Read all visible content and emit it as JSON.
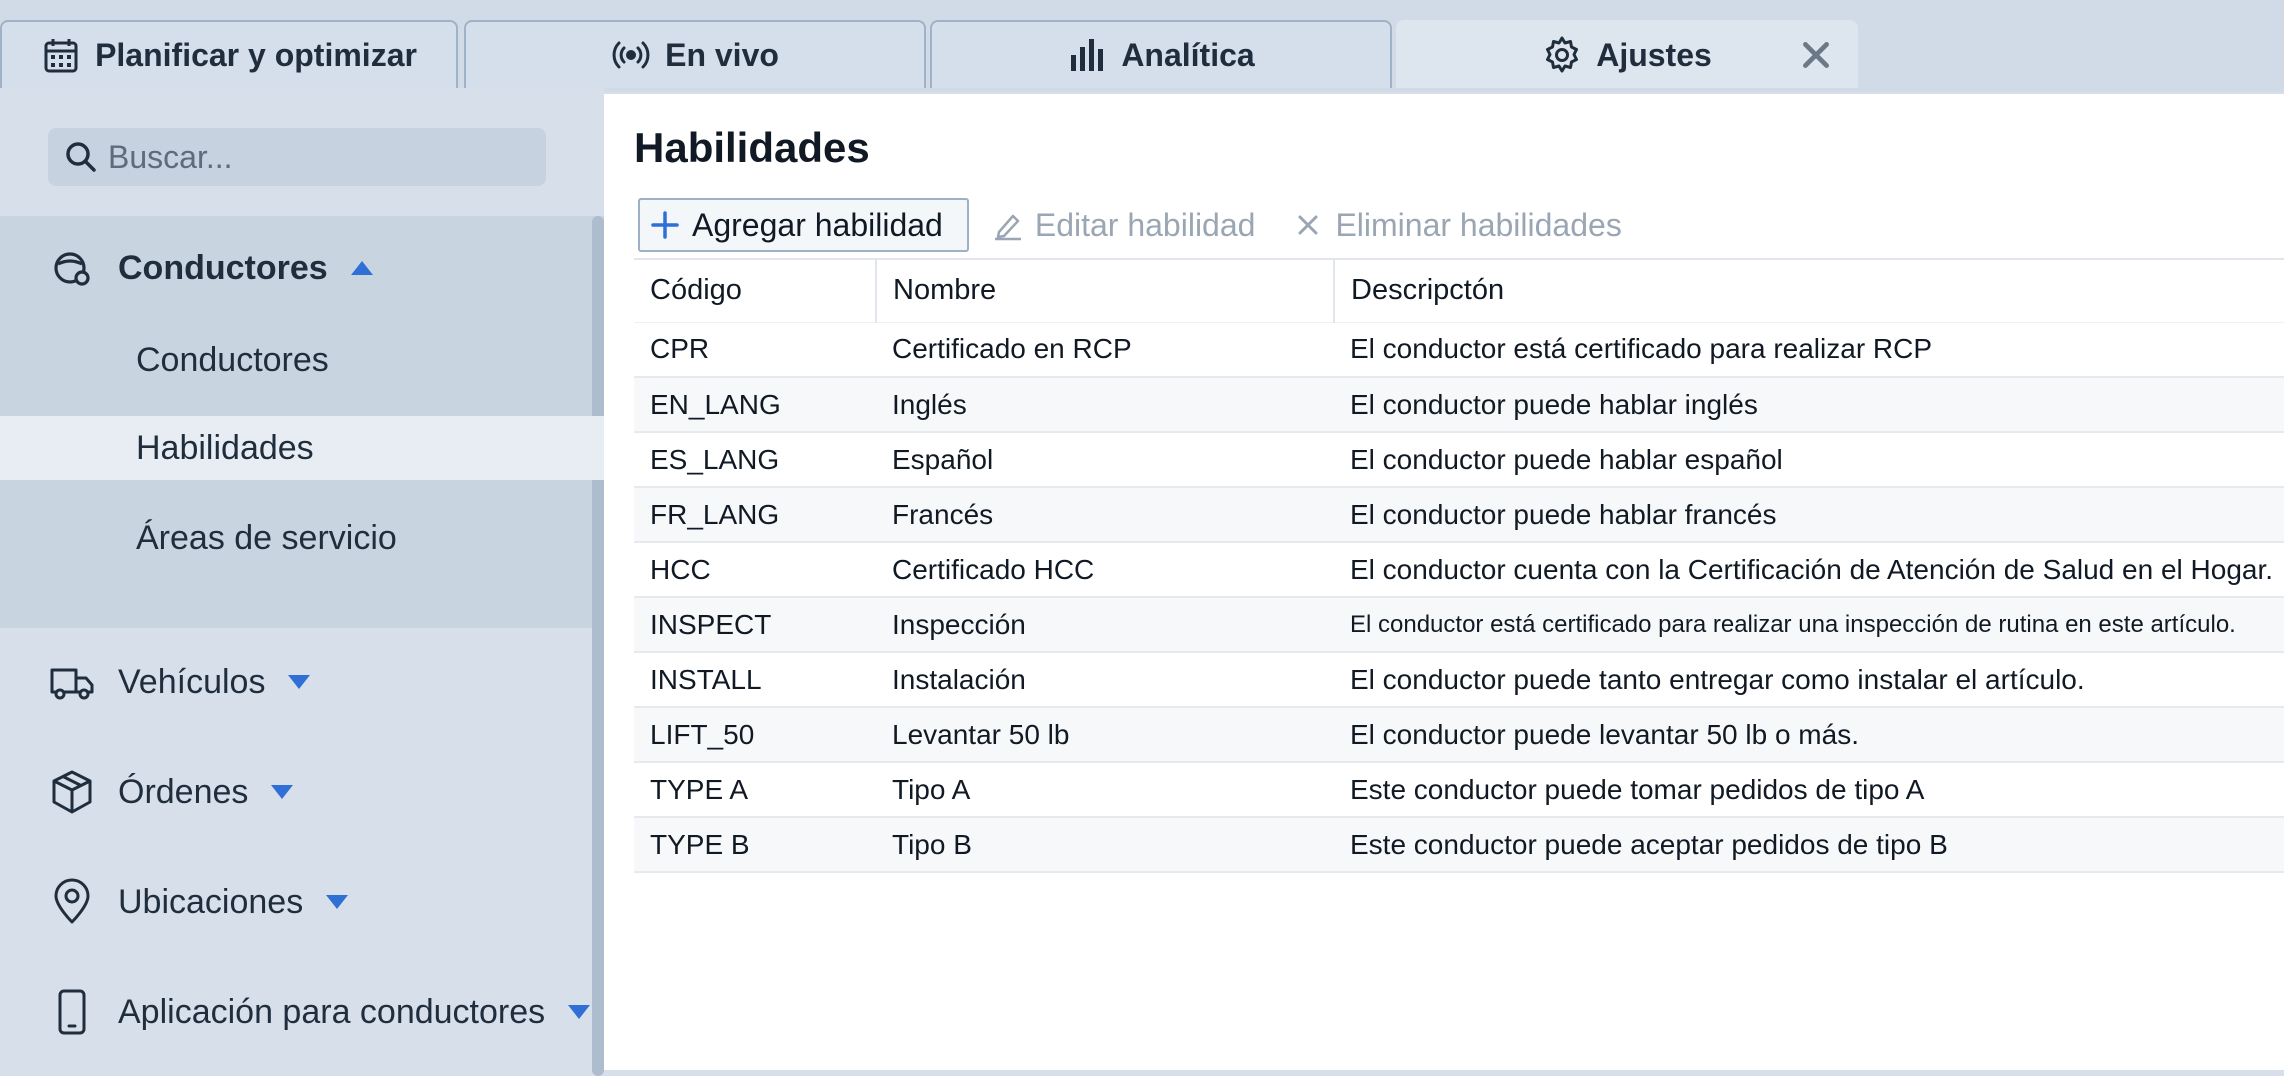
{
  "tabs": [
    {
      "label": "Planificar y optimizar",
      "icon": "calendar-icon"
    },
    {
      "label": "En vivo",
      "icon": "broadcast-icon"
    },
    {
      "label": "Analítica",
      "icon": "bar-chart-icon"
    },
    {
      "label": "Ajustes",
      "icon": "gear-icon",
      "active": true
    }
  ],
  "sidebar": {
    "search_placeholder": "Buscar...",
    "groups": [
      {
        "label": "Conductores",
        "icon": "driver-icon",
        "expanded": true,
        "items": [
          {
            "label": "Conductores"
          },
          {
            "label": "Habilidades",
            "selected": true
          },
          {
            "label": "Áreas de servicio"
          }
        ]
      },
      {
        "label": "Vehículos",
        "icon": "truck-icon"
      },
      {
        "label": "Órdenes",
        "icon": "package-icon"
      },
      {
        "label": "Ubicaciones",
        "icon": "location-pin-icon"
      },
      {
        "label": "Aplicación para conductores",
        "icon": "mobile-phone-icon"
      }
    ]
  },
  "main": {
    "title": "Habilidades",
    "toolbar": {
      "add_label": "Agregar habilidad",
      "edit_label": "Editar habilidad",
      "delete_label": "Eliminar habilidades"
    },
    "table": {
      "headers": [
        "Código",
        "Nombre",
        "Descripctón"
      ],
      "rows": [
        [
          "CPR",
          "Certificado en RCP",
          "El conductor está certificado para realizar RCP"
        ],
        [
          "EN_LANG",
          "Inglés",
          "El conductor puede hablar inglés"
        ],
        [
          "ES_LANG",
          "Español",
          "El conductor puede hablar español"
        ],
        [
          "FR_LANG",
          "Francés",
          "El conductor puede hablar francés"
        ],
        [
          "HCC",
          "Certificado HCC",
          "El conductor cuenta con la Certificación de Atención de Salud en el Hogar."
        ],
        [
          "INSPECT",
          "Inspección",
          "El conductor está certificado para realizar una inspección de rutina en este artículo."
        ],
        [
          "INSTALL",
          "Instalación",
          "El conductor puede tanto entregar como instalar el artículo."
        ],
        [
          "LIFT_50",
          "Levantar 50 lb",
          "El conductor puede levantar 50 lb o más."
        ],
        [
          "TYPE A",
          "Tipo A",
          "Este conductor puede tomar pedidos de tipo A"
        ],
        [
          "TYPE B",
          "Tipo B",
          "Este conductor puede aceptar pedidos de tipo B"
        ]
      ]
    }
  },
  "colors": {
    "sidebar_bg": "#d6dfea",
    "caret_blue": "#2f6fd6",
    "accent_blue": "#2f6fd6",
    "disabled_text": "#9aa6b3"
  }
}
